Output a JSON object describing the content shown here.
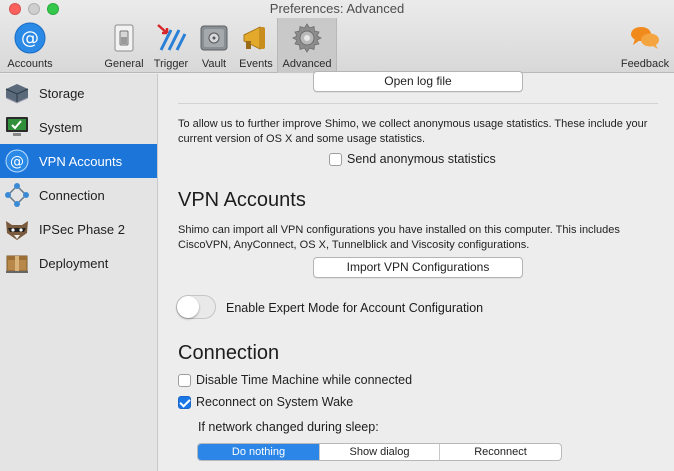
{
  "window": {
    "title": "Preferences: Advanced"
  },
  "toolbar": {
    "accounts": "Accounts",
    "general": "General",
    "trigger": "Trigger",
    "vault": "Vault",
    "events": "Events",
    "advanced": "Advanced",
    "feedback": "Feedback"
  },
  "sidebar": {
    "items": [
      {
        "label": "Storage",
        "icon": "storage-icon"
      },
      {
        "label": "System",
        "icon": "system-icon"
      },
      {
        "label": "VPN Accounts",
        "icon": "at-icon"
      },
      {
        "label": "Connection",
        "icon": "connection-icon"
      },
      {
        "label": "IPSec Phase 2",
        "icon": "raccoon-icon"
      },
      {
        "label": "Deployment",
        "icon": "box-icon"
      }
    ],
    "active_index": 2
  },
  "storage": {
    "open_log_button": "Open log file"
  },
  "system": {
    "description": "To allow us to further improve Shimo, we collect anonymous usage statistics. These include your current version of OS X and some usage statistics.",
    "send_stats_label": "Send anonymous statistics",
    "send_stats_checked": false
  },
  "vpn_accounts": {
    "heading": "VPN Accounts",
    "description": "Shimo can import all VPN configurations you have installed on this computer. This includes CiscoVPN, AnyConnect, OS X, Tunnelblick and Viscosity configurations.",
    "import_button": "Import VPN Configurations",
    "expert_mode_label": "Enable Expert Mode for Account Configuration",
    "expert_mode_on": false
  },
  "connection": {
    "heading": "Connection",
    "disable_tm_label": "Disable Time Machine while connected",
    "disable_tm_checked": false,
    "reconnect_label": "Reconnect on System Wake",
    "reconnect_checked": true,
    "network_changed_label": "If network changed during sleep:",
    "options": [
      "Do nothing",
      "Show dialog",
      "Reconnect"
    ],
    "selected_option": "Do nothing"
  },
  "colors": {
    "accent": "#1c75d9",
    "selected_segment": "#2b86e8"
  }
}
